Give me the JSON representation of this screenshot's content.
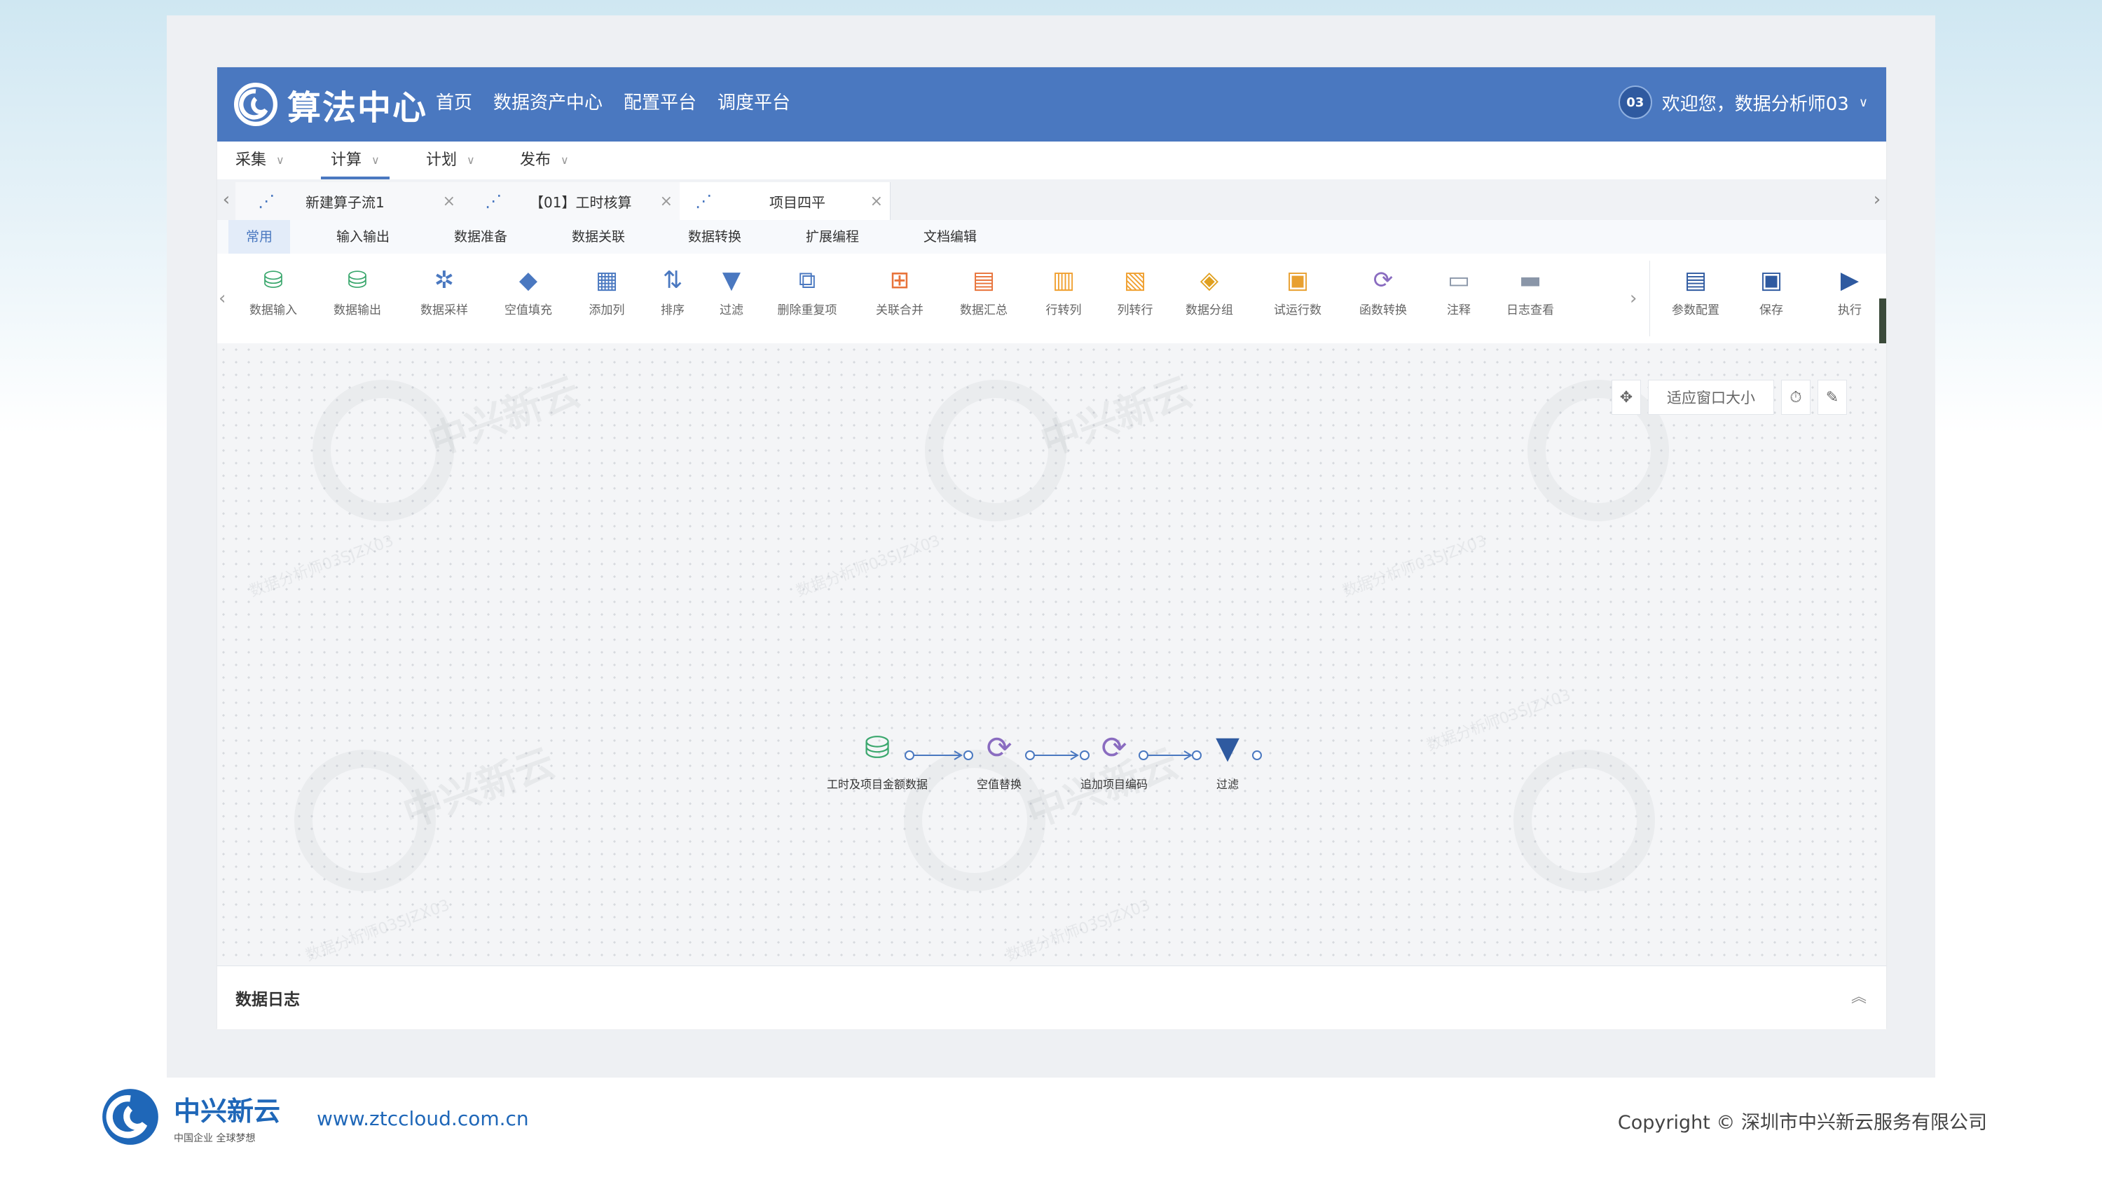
{
  "header": {
    "app_title": "算法中心",
    "nav": [
      "首页",
      "数据资产中心",
      "配置平台",
      "调度平台"
    ],
    "avatar_text": "03",
    "user_greeting": "欢迎您，数据分析师03"
  },
  "menubar": {
    "items": [
      "采集",
      "计算",
      "计划",
      "发布"
    ],
    "active": "计算"
  },
  "tabs": [
    {
      "label": "新建算子流1"
    },
    {
      "label": "【01】工时核算"
    },
    {
      "label": "项目四平"
    }
  ],
  "categories": [
    "常用",
    "输入输出",
    "数据准备",
    "数据关联",
    "数据转换",
    "扩展编程",
    "文档编辑"
  ],
  "toolbar": {
    "tools": [
      {
        "label": "数据输入",
        "icon": "database-input-icon",
        "color": "#3aa76d",
        "glyph": "⛁"
      },
      {
        "label": "数据输出",
        "icon": "database-output-icon",
        "color": "#3aa76d",
        "glyph": "⛁"
      },
      {
        "label": "数据采样",
        "icon": "sample-icon",
        "color": "#4a78c0",
        "glyph": "✲"
      },
      {
        "label": "空值填充",
        "icon": "fill-icon",
        "color": "#4a78c0",
        "glyph": "◆"
      },
      {
        "label": "添加列",
        "icon": "add-column-icon",
        "color": "#4a78c0",
        "glyph": "▦"
      },
      {
        "label": "排序",
        "icon": "sort-icon",
        "color": "#4a78c0",
        "glyph": "⇅"
      },
      {
        "label": "过滤",
        "icon": "filter-icon",
        "color": "#4a78c0",
        "glyph": "▼"
      },
      {
        "label": "删除重复项",
        "icon": "dedupe-icon",
        "color": "#4a78c0",
        "glyph": "⧉"
      },
      {
        "label": "关联合并",
        "icon": "join-icon",
        "color": "#e8733a",
        "glyph": "⊞"
      },
      {
        "label": "数据汇总",
        "icon": "aggregate-icon",
        "color": "#e8733a",
        "glyph": "▤"
      },
      {
        "label": "行转列",
        "icon": "pivot-icon",
        "color": "#f0a030",
        "glyph": "▥"
      },
      {
        "label": "列转行",
        "icon": "unpivot-icon",
        "color": "#f0a030",
        "glyph": "▧"
      },
      {
        "label": "数据分组",
        "icon": "group-icon",
        "color": "#e0a020",
        "glyph": "◈"
      },
      {
        "label": "试运行数",
        "icon": "trial-run-icon",
        "color": "#e8a030",
        "glyph": "▣"
      },
      {
        "label": "函数转换",
        "icon": "function-icon",
        "color": "#8a6cc0",
        "glyph": "⟳"
      },
      {
        "label": "注释",
        "icon": "comment-icon",
        "color": "#8a96a8",
        "glyph": "▭"
      },
      {
        "label": "日志查看",
        "icon": "log-icon",
        "color": "#8a96a8",
        "glyph": "▬"
      }
    ],
    "right_tools": [
      {
        "label": "参数配置",
        "icon": "params-icon",
        "color": "#2f5aa0",
        "glyph": "▤"
      },
      {
        "label": "保存",
        "icon": "save-icon",
        "color": "#2f5aa0",
        "glyph": "▣"
      },
      {
        "label": "执行",
        "icon": "run-icon",
        "color": "#2f5aa0",
        "glyph": "▶"
      }
    ]
  },
  "canvas": {
    "fit_label": "适应窗口大小",
    "watermark_brand": "中兴新云",
    "watermark_user": "数据分析师03SJZX03",
    "nodes": [
      {
        "label": "工时及项目金额数据",
        "icon": "database-input-icon",
        "color": "#3aa76d",
        "glyph": "⛁"
      },
      {
        "label": "空值替换",
        "icon": "function-icon",
        "color": "#8a6cc0",
        "glyph": "⟳"
      },
      {
        "label": "追加项目编码",
        "icon": "function-icon",
        "color": "#8a6cc0",
        "glyph": "⟳"
      },
      {
        "label": "过滤",
        "icon": "filter-icon",
        "color": "#2f5aa0",
        "glyph": "▼"
      }
    ]
  },
  "log_panel": {
    "title": "数据日志"
  },
  "footer": {
    "brand": "中兴新云",
    "slogan": "中国企业 全球梦想",
    "url": "www.ztccloud.com.cn",
    "copyright": "Copyright © 深圳市中兴新云服务有限公司"
  }
}
